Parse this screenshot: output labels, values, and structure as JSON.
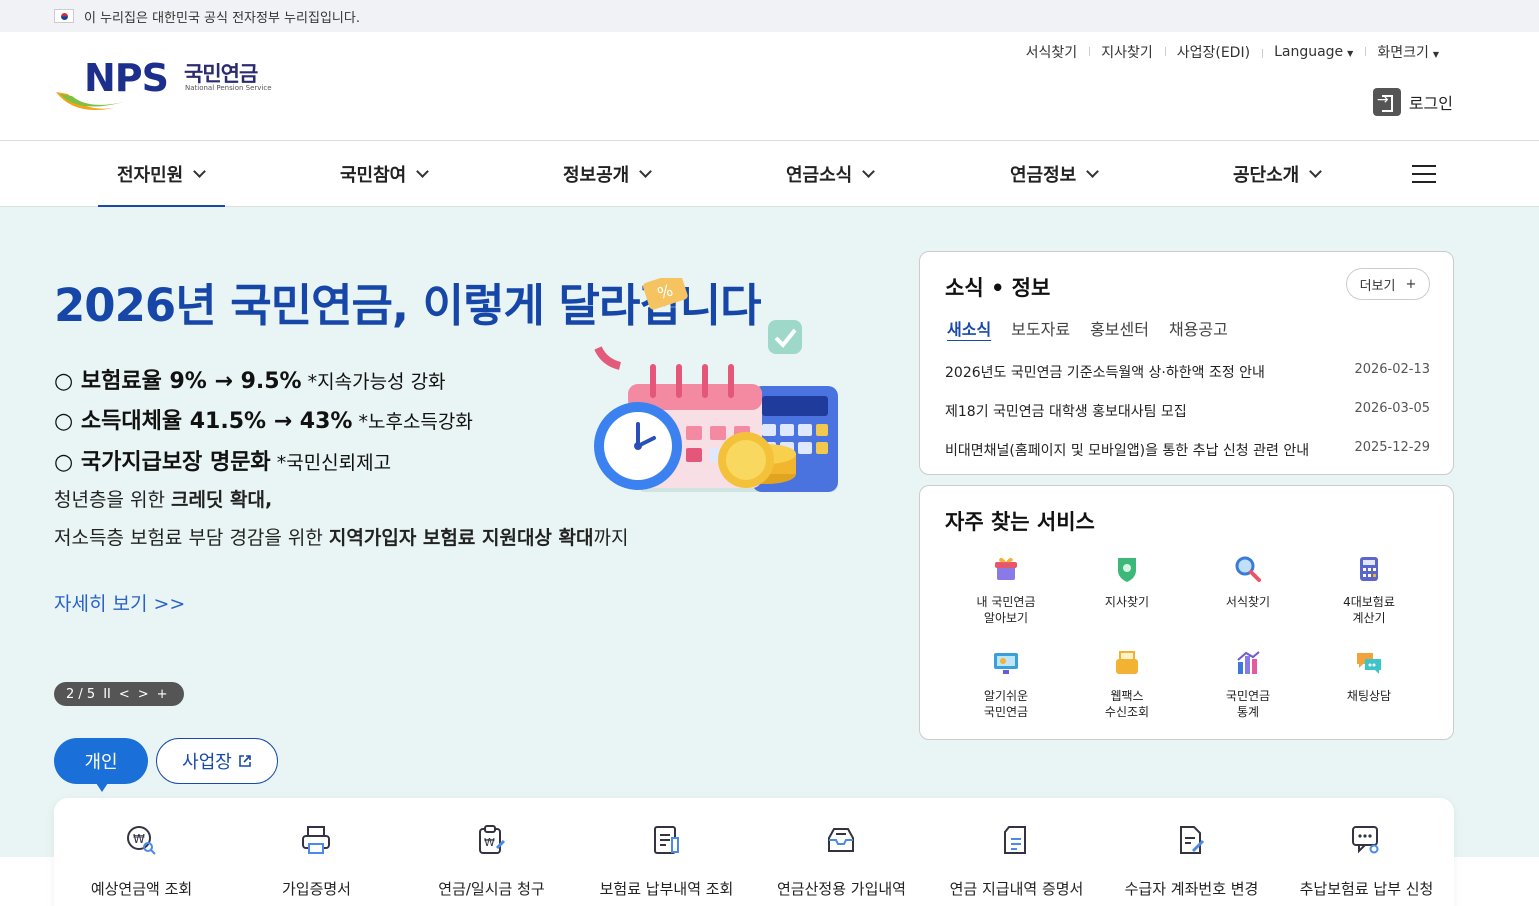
{
  "gov_banner": {
    "text": "이 누리집은 대한민국 공식 전자정부 누리집입니다."
  },
  "logo": {
    "mark": "NPS",
    "name_kr": "국민연금",
    "name_en": "National Pension Service"
  },
  "util_links": [
    "서식찾기",
    "지사찾기",
    "사업장(EDI)",
    "Language",
    "화면크기"
  ],
  "login_label": "로그인",
  "gnb": [
    "전자민원",
    "국민참여",
    "정보공개",
    "연금소식",
    "연금정보",
    "공단소개"
  ],
  "hero": {
    "title": "2026년 국민연금, 이렇게 달라집니다",
    "line1": {
      "main": "○ 보험료율 9% → 9.5%",
      "note": " *지속가능성 강화"
    },
    "line2": {
      "main": "○ 소득대체율 41.5% → 43%",
      "note": " *노후소득강화"
    },
    "line3": {
      "main": "○ 국가지급보장 명문화",
      "note": " *국민신뢰제고"
    },
    "sub1_pre": "청년층을 위한 ",
    "sub1_bold": "크레딧 확대,",
    "sub2_pre": "저소득층 보험료 부담 경감을 위한 ",
    "sub2_bold": "지역가입자 보험료 지원대상 확대",
    "sub2_post": "까지",
    "more": "자세히 보기 >>",
    "pager": {
      "page": "2 / 5",
      "pause": "II",
      "prev": "<",
      "next": ">",
      "plus": "+"
    }
  },
  "tabs": {
    "person": "개인",
    "business": "사업장"
  },
  "quick_menu": [
    {
      "label": "예상연금액 조회",
      "icon": "coin-search-icon"
    },
    {
      "label": "가입증명서",
      "icon": "printer-icon"
    },
    {
      "label": "연금/일시금 청구",
      "icon": "clipboard-won-icon"
    },
    {
      "label": "보험료 납부내역 조회",
      "icon": "document-list-icon"
    },
    {
      "label": "연금산정용 가입내역",
      "icon": "inbox-icon"
    },
    {
      "label": "연금 지급내역 증명서",
      "icon": "certificate-icon"
    },
    {
      "label": "수급자 계좌번호 변경",
      "icon": "document-edit-icon"
    },
    {
      "label": "추납보험료 납부 신청",
      "icon": "chat-search-icon"
    }
  ],
  "news": {
    "title": "소식 • 정보",
    "more": "더보기",
    "tabs": [
      "새소식",
      "보도자료",
      "홍보센터",
      "채용공고"
    ],
    "items": [
      {
        "title": "2026년도 국민연금 기준소득월액 상·하한액 조정 안내",
        "date": "2026-02-13"
      },
      {
        "title": "제18기 국민연금 대학생 홍보대사팀 모집",
        "date": "2026-03-05"
      },
      {
        "title": "비대면채널(홈페이지 및 모바일앱)을 통한 추납 신청 관련 안내",
        "date": "2025-12-29"
      }
    ]
  },
  "services": {
    "title": "자주 찾는 서비스",
    "items": [
      {
        "label": "내 국민연금\n알아보기",
        "icon": "gift-icon",
        "color": "#e8566b"
      },
      {
        "label": "지사찾기",
        "icon": "location-shield-icon",
        "color": "#3cb878"
      },
      {
        "label": "서식찾기",
        "icon": "magnifier-icon",
        "color": "#3a7ad9"
      },
      {
        "label": "4대보험료\n계산기",
        "icon": "calculator-icon",
        "color": "#5a66c8"
      },
      {
        "label": "알기쉬운\n국민연금",
        "icon": "monitor-icon",
        "color": "#3aa0d9"
      },
      {
        "label": "웹팩스\n수신조회",
        "icon": "fax-icon",
        "color": "#f2b233"
      },
      {
        "label": "국민연금\n통계",
        "icon": "chart-icon",
        "color": "#6a5ad9"
      },
      {
        "label": "채팅상담",
        "icon": "chat-bubbles-icon",
        "color": "#f2a23a"
      }
    ]
  }
}
